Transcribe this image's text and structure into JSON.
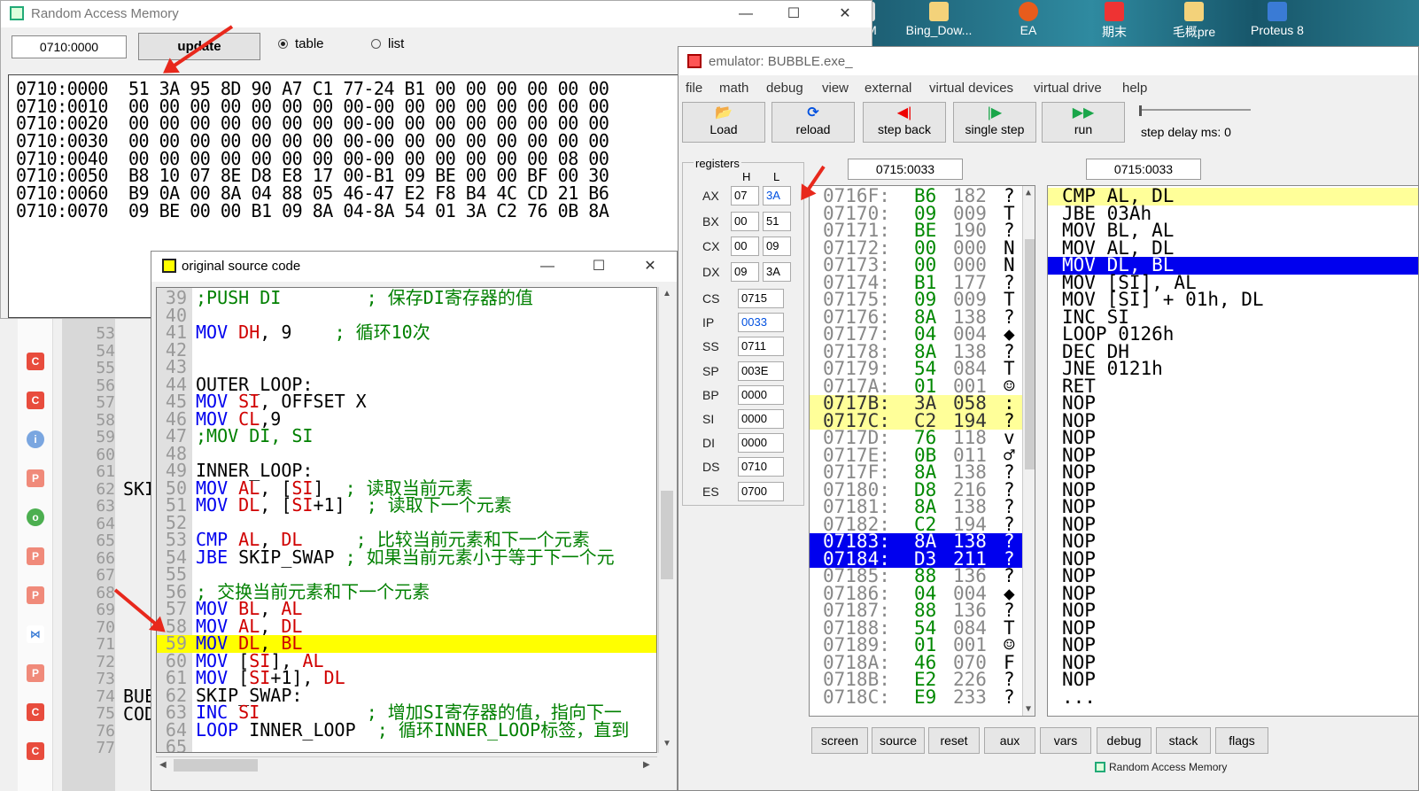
{
  "desktop": {
    "icons": [
      "Bing_Dow...",
      "EA",
      "期末",
      "毛概pre",
      "Proteus 8"
    ],
    "partial": "M"
  },
  "ram": {
    "title": "Random Access Memory",
    "address_value": "0710:0000",
    "update_label": "update",
    "radio_table": "table",
    "radio_list": "list",
    "selected_view": "table",
    "dump": [
      "0710:0000  51 3A 95 8D 90 A7 C1 77-24 B1 00 00 00 00 00 00",
      "0710:0010  00 00 00 00 00 00 00 00-00 00 00 00 00 00 00 00",
      "0710:0020  00 00 00 00 00 00 00 00-00 00 00 00 00 00 00 00",
      "0710:0030  00 00 00 00 00 00 00 00-00 00 00 00 00 00 00 00",
      "0710:0040  00 00 00 00 00 00 00 00-00 00 00 00 00 00 08 00",
      "0710:0050  B8 10 07 8E D8 E8 17 00-B1 09 BE 00 00 BF 00 30",
      "0710:0060  B9 0A 00 8A 04 88 05 46-47 E2 F8 B4 4C CD 21 B6",
      "0710:0070  09 BE 00 00 B1 09 8A 04-8A 54 01 3A C2 76 0B 8A"
    ]
  },
  "source": {
    "title": "original source code",
    "lines": [
      {
        "n": "39",
        "code": ";PUSH DI        ; 保存DI寄存器的值",
        "cls": "cm"
      },
      {
        "n": "40",
        "code": "",
        "cls": "tx"
      },
      {
        "n": "41",
        "code": "MOV DH, 9    ; 循环10次",
        "cls": "mix"
      },
      {
        "n": "42",
        "code": "",
        "cls": "tx"
      },
      {
        "n": "43",
        "code": "",
        "cls": "tx"
      },
      {
        "n": "44",
        "code": "OUTER_LOOP:",
        "cls": "tx"
      },
      {
        "n": "45",
        "code": "MOV SI, OFFSET X",
        "cls": "mix"
      },
      {
        "n": "46",
        "code": "MOV CL,9",
        "cls": "mix"
      },
      {
        "n": "47",
        "code": ";MOV DI, SI",
        "cls": "cm"
      },
      {
        "n": "48",
        "code": "",
        "cls": "tx"
      },
      {
        "n": "49",
        "code": "INNER_LOOP:",
        "cls": "tx"
      },
      {
        "n": "50",
        "code": "MOV AL, [SI]  ; 读取当前元素",
        "cls": "mix"
      },
      {
        "n": "51",
        "code": "MOV DL, [SI+1]  ; 读取下一个元素",
        "cls": "mix"
      },
      {
        "n": "52",
        "code": "",
        "cls": "tx"
      },
      {
        "n": "53",
        "code": "CMP AL, DL     ; 比较当前元素和下一个元素",
        "cls": "mix"
      },
      {
        "n": "54",
        "code": "JBE SKIP_SWAP ; 如果当前元素小于等于下一个元",
        "cls": "mix"
      },
      {
        "n": "55",
        "code": "",
        "cls": "tx"
      },
      {
        "n": "56",
        "code": "; 交换当前元素和下一个元素",
        "cls": "cm"
      },
      {
        "n": "57",
        "code": "MOV BL, AL",
        "cls": "mix"
      },
      {
        "n": "58",
        "code": "MOV AL, DL",
        "cls": "mix"
      },
      {
        "n": "59",
        "code": "MOV DL, BL",
        "cls": "mix"
      },
      {
        "n": "60",
        "code": "MOV [SI], AL",
        "cls": "mix"
      },
      {
        "n": "61",
        "code": "MOV [SI+1], DL",
        "cls": "mix"
      },
      {
        "n": "62",
        "code": "SKIP_SWAP:",
        "cls": "tx"
      },
      {
        "n": "63",
        "code": "INC SI          ; 增加SI寄存器的值，指向下一",
        "cls": "mix"
      },
      {
        "n": "64",
        "code": "LOOP INNER_LOOP  ; 循环INNER_LOOP标签，直到",
        "cls": "mix"
      },
      {
        "n": "65",
        "code": "",
        "cls": "tx"
      }
    ],
    "highlight_line": "59"
  },
  "background_editor": {
    "gutter_lines": [
      "53",
      "54",
      "55",
      "56",
      "57",
      "58",
      "59",
      "60",
      "61",
      "62",
      "63",
      "64",
      "65",
      "66",
      "67",
      "68",
      "69",
      "70",
      "71",
      "72",
      "73",
      "74",
      "75",
      "76",
      "77"
    ],
    "fragments": [
      "SKI",
      "BUE",
      "COD"
    ]
  },
  "emulator": {
    "title": "emulator: BUBBLE.exe_",
    "menu": [
      "file",
      "math",
      "debug",
      "view",
      "external",
      "virtual devices",
      "virtual drive",
      "help"
    ],
    "toolbar": [
      "Load",
      "reload",
      "step back",
      "single step",
      "run"
    ],
    "step_delay": "step delay ms: 0",
    "registers_label": "registers",
    "col_h": "H",
    "col_l": "L",
    "regs_hl": [
      {
        "name": "AX",
        "h": "07",
        "l": "3A"
      },
      {
        "name": "BX",
        "h": "00",
        "l": "51"
      },
      {
        "name": "CX",
        "h": "00",
        "l": "09"
      },
      {
        "name": "DX",
        "h": "09",
        "l": "3A"
      }
    ],
    "regs_seg": [
      {
        "name": "CS",
        "v": "0715"
      },
      {
        "name": "IP",
        "v": "0033"
      },
      {
        "name": "SS",
        "v": "0711"
      },
      {
        "name": "SP",
        "v": "003E"
      },
      {
        "name": "BP",
        "v": "0000"
      },
      {
        "name": "SI",
        "v": "0000"
      },
      {
        "name": "DI",
        "v": "0000"
      },
      {
        "name": "DS",
        "v": "0710"
      },
      {
        "name": "ES",
        "v": "0700"
      }
    ],
    "mem_addr": "0715:0033",
    "dis_addr": "0715:0033",
    "memory": [
      {
        "a": "0716F:",
        "h": "B6",
        "d": "182",
        "c": "?",
        "s": ""
      },
      {
        "a": "07170:",
        "h": "09",
        "d": "009",
        "c": "T",
        "s": ""
      },
      {
        "a": "07171:",
        "h": "BE",
        "d": "190",
        "c": "?",
        "s": ""
      },
      {
        "a": "07172:",
        "h": "00",
        "d": "000",
        "c": "N",
        "s": ""
      },
      {
        "a": "07173:",
        "h": "00",
        "d": "000",
        "c": "N",
        "s": ""
      },
      {
        "a": "07174:",
        "h": "B1",
        "d": "177",
        "c": "?",
        "s": ""
      },
      {
        "a": "07175:",
        "h": "09",
        "d": "009",
        "c": "T",
        "s": ""
      },
      {
        "a": "07176:",
        "h": "8A",
        "d": "138",
        "c": "?",
        "s": ""
      },
      {
        "a": "07177:",
        "h": "04",
        "d": "004",
        "c": "◆",
        "s": ""
      },
      {
        "a": "07178:",
        "h": "8A",
        "d": "138",
        "c": "?",
        "s": ""
      },
      {
        "a": "07179:",
        "h": "54",
        "d": "084",
        "c": "T",
        "s": ""
      },
      {
        "a": "0717A:",
        "h": "01",
        "d": "001",
        "c": "☺",
        "s": ""
      },
      {
        "a": "0717B:",
        "h": "3A",
        "d": "058",
        "c": ":",
        "s": "y"
      },
      {
        "a": "0717C:",
        "h": "C2",
        "d": "194",
        "c": "?",
        "s": "y"
      },
      {
        "a": "0717D:",
        "h": "76",
        "d": "118",
        "c": "v",
        "s": ""
      },
      {
        "a": "0717E:",
        "h": "0B",
        "d": "011",
        "c": "♂",
        "s": ""
      },
      {
        "a": "0717F:",
        "h": "8A",
        "d": "138",
        "c": "?",
        "s": ""
      },
      {
        "a": "07180:",
        "h": "D8",
        "d": "216",
        "c": "?",
        "s": ""
      },
      {
        "a": "07181:",
        "h": "8A",
        "d": "138",
        "c": "?",
        "s": ""
      },
      {
        "a": "07182:",
        "h": "C2",
        "d": "194",
        "c": "?",
        "s": ""
      },
      {
        "a": "07183:",
        "h": "8A",
        "d": "138",
        "c": "?",
        "s": "b"
      },
      {
        "a": "07184:",
        "h": "D3",
        "d": "211",
        "c": "?",
        "s": "b"
      },
      {
        "a": "07185:",
        "h": "88",
        "d": "136",
        "c": "?",
        "s": ""
      },
      {
        "a": "07186:",
        "h": "04",
        "d": "004",
        "c": "◆",
        "s": ""
      },
      {
        "a": "07187:",
        "h": "88",
        "d": "136",
        "c": "?",
        "s": ""
      },
      {
        "a": "07188:",
        "h": "54",
        "d": "084",
        "c": "T",
        "s": ""
      },
      {
        "a": "07189:",
        "h": "01",
        "d": "001",
        "c": "☺",
        "s": ""
      },
      {
        "a": "0718A:",
        "h": "46",
        "d": "070",
        "c": "F",
        "s": ""
      },
      {
        "a": "0718B:",
        "h": "E2",
        "d": "226",
        "c": "?",
        "s": ""
      },
      {
        "a": "0718C:",
        "h": "E9",
        "d": "233",
        "c": "?",
        "s": ""
      }
    ],
    "disasm": [
      {
        "t": "CMP AL, DL",
        "s": "y"
      },
      {
        "t": "JBE 03Ah",
        "s": ""
      },
      {
        "t": "MOV BL, AL",
        "s": ""
      },
      {
        "t": "MOV AL, DL",
        "s": ""
      },
      {
        "t": "MOV DL, BL",
        "s": "b"
      },
      {
        "t": "MOV [SI], AL",
        "s": ""
      },
      {
        "t": "MOV [SI] + 01h, DL",
        "s": ""
      },
      {
        "t": "INC SI",
        "s": ""
      },
      {
        "t": "LOOP 0126h",
        "s": ""
      },
      {
        "t": "DEC DH",
        "s": ""
      },
      {
        "t": "JNE 0121h",
        "s": ""
      },
      {
        "t": "RET",
        "s": ""
      },
      {
        "t": "NOP",
        "s": ""
      },
      {
        "t": "NOP",
        "s": ""
      },
      {
        "t": "NOP",
        "s": ""
      },
      {
        "t": "NOP",
        "s": ""
      },
      {
        "t": "NOP",
        "s": ""
      },
      {
        "t": "NOP",
        "s": ""
      },
      {
        "t": "NOP",
        "s": ""
      },
      {
        "t": "NOP",
        "s": ""
      },
      {
        "t": "NOP",
        "s": ""
      },
      {
        "t": "NOP",
        "s": ""
      },
      {
        "t": "NOP",
        "s": ""
      },
      {
        "t": "NOP",
        "s": ""
      },
      {
        "t": "NOP",
        "s": ""
      },
      {
        "t": "NOP",
        "s": ""
      },
      {
        "t": "NOP",
        "s": ""
      },
      {
        "t": "NOP",
        "s": ""
      },
      {
        "t": "NOP",
        "s": ""
      },
      {
        "t": "...",
        "s": ""
      }
    ],
    "bottom_buttons": [
      "screen",
      "source",
      "reset",
      "aux",
      "vars",
      "debug",
      "stack",
      "flags"
    ],
    "taskbar_peek": "Random Access Memory"
  },
  "colors": {
    "highlight_yellow": "#ffff00",
    "select_blue": "#0000ee",
    "keyword_blue": "#0000ee",
    "register_red": "#d00000",
    "comment_green": "#008000",
    "arrow_red": "#e8281c"
  }
}
